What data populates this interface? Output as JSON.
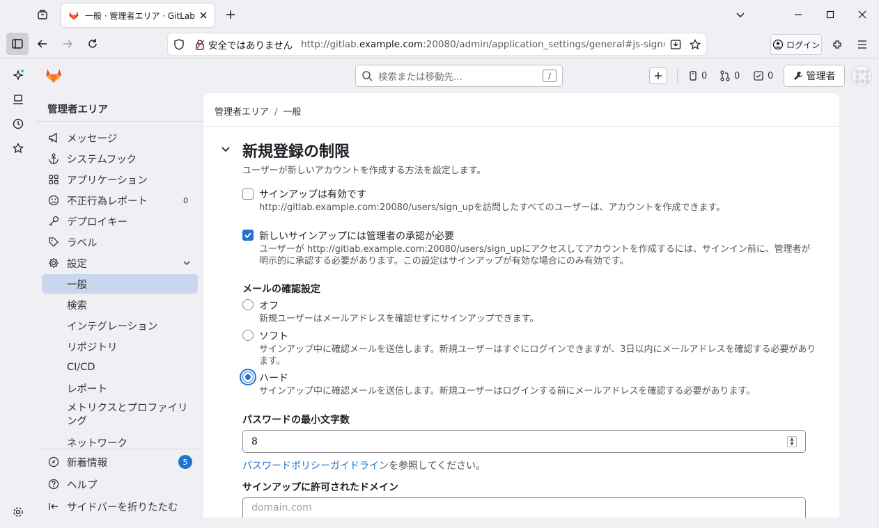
{
  "browser": {
    "tab_title": "一般 · 管理者エリア · GitLab",
    "insecure_label": "安全ではありません",
    "url_prefix": "http://gitlab.",
    "url_host": "example.com",
    "url_rest": ":20080/admin/application_settings/general#js-signup-settings",
    "login_label": "ログイン"
  },
  "header": {
    "search_placeholder": "検索または移動先...",
    "search_shortcut": "/",
    "issues_count": "0",
    "mr_count": "0",
    "todo_count": "0",
    "admin_label": "管理者"
  },
  "sidebar": {
    "section_title": "管理者エリア",
    "items": [
      {
        "label": "メッセージ",
        "icon": "megaphone-icon"
      },
      {
        "label": "システムフック",
        "icon": "anchor-icon"
      },
      {
        "label": "アプリケーション",
        "icon": "apps-icon"
      },
      {
        "label": "不正行為レポート",
        "icon": "abuse-icon",
        "count": "0"
      },
      {
        "label": "デプロイキー",
        "icon": "key-icon"
      },
      {
        "label": "ラベル",
        "icon": "label-icon"
      },
      {
        "label": "設定",
        "icon": "gear-icon"
      }
    ],
    "sub_items": [
      {
        "label": "一般",
        "active": true
      },
      {
        "label": "検索"
      },
      {
        "label": "インテグレーション"
      },
      {
        "label": "リポジトリ"
      },
      {
        "label": "CI/CD"
      },
      {
        "label": "レポート"
      },
      {
        "label": "メトリクスとプロファイリング"
      },
      {
        "label": "ネットワーク"
      }
    ],
    "whats_new_label": "新着情報",
    "whats_new_count": "5",
    "help_label": "ヘルプ",
    "collapse_label": "サイドバーを折りたたむ"
  },
  "breadcrumb": {
    "root": "管理者エリア",
    "sep": "/",
    "current": "一般"
  },
  "signup": {
    "title": "新規登録の制限",
    "description": "ユーザーが新しいアカウントを作成する方法を設定します。",
    "signup_enabled_label": "サインアップは有効です",
    "signup_enabled_help": "http://gitlab.example.com:20080/users/sign_upを訪問したすべてのユーザーは、アカウントを作成できます。",
    "signup_enabled_checked": false,
    "approval_label": "新しいサインアップには管理者の承認が必要",
    "approval_help": "ユーザーが http://gitlab.example.com:20080/users/sign_upにアクセスしてアカウントを作成するには、サインイン前に、管理者が明示的に承認する必要があります。この設定はサインアップが有効な場合にのみ有効です。",
    "approval_checked": true,
    "email_confirm_title": "メールの確認設定",
    "email_options": [
      {
        "label": "オフ",
        "help": "新規ユーザーはメールアドレスを確認せずにサインアップできます。",
        "selected": false
      },
      {
        "label": "ソフト",
        "help": "サインアップ中に確認メールを送信します。新規ユーザーはすぐにログインできますが、3日以内にメールアドレスを確認する必要があります。",
        "selected": false
      },
      {
        "label": "ハード",
        "help": "サインアップ中に確認メールを送信します。新規ユーザーはログインする前にメールアドレスを確認する必要があります。",
        "selected": true
      }
    ],
    "pw_min_label": "パスワードの最小文字数",
    "pw_min_value": "8",
    "pw_help_link": "パスワードポリシーガイドライン",
    "pw_help_rest": "を参照してください。",
    "domain_label": "サインアップに許可されたドメイン",
    "domain_placeholder": "domain.com"
  }
}
